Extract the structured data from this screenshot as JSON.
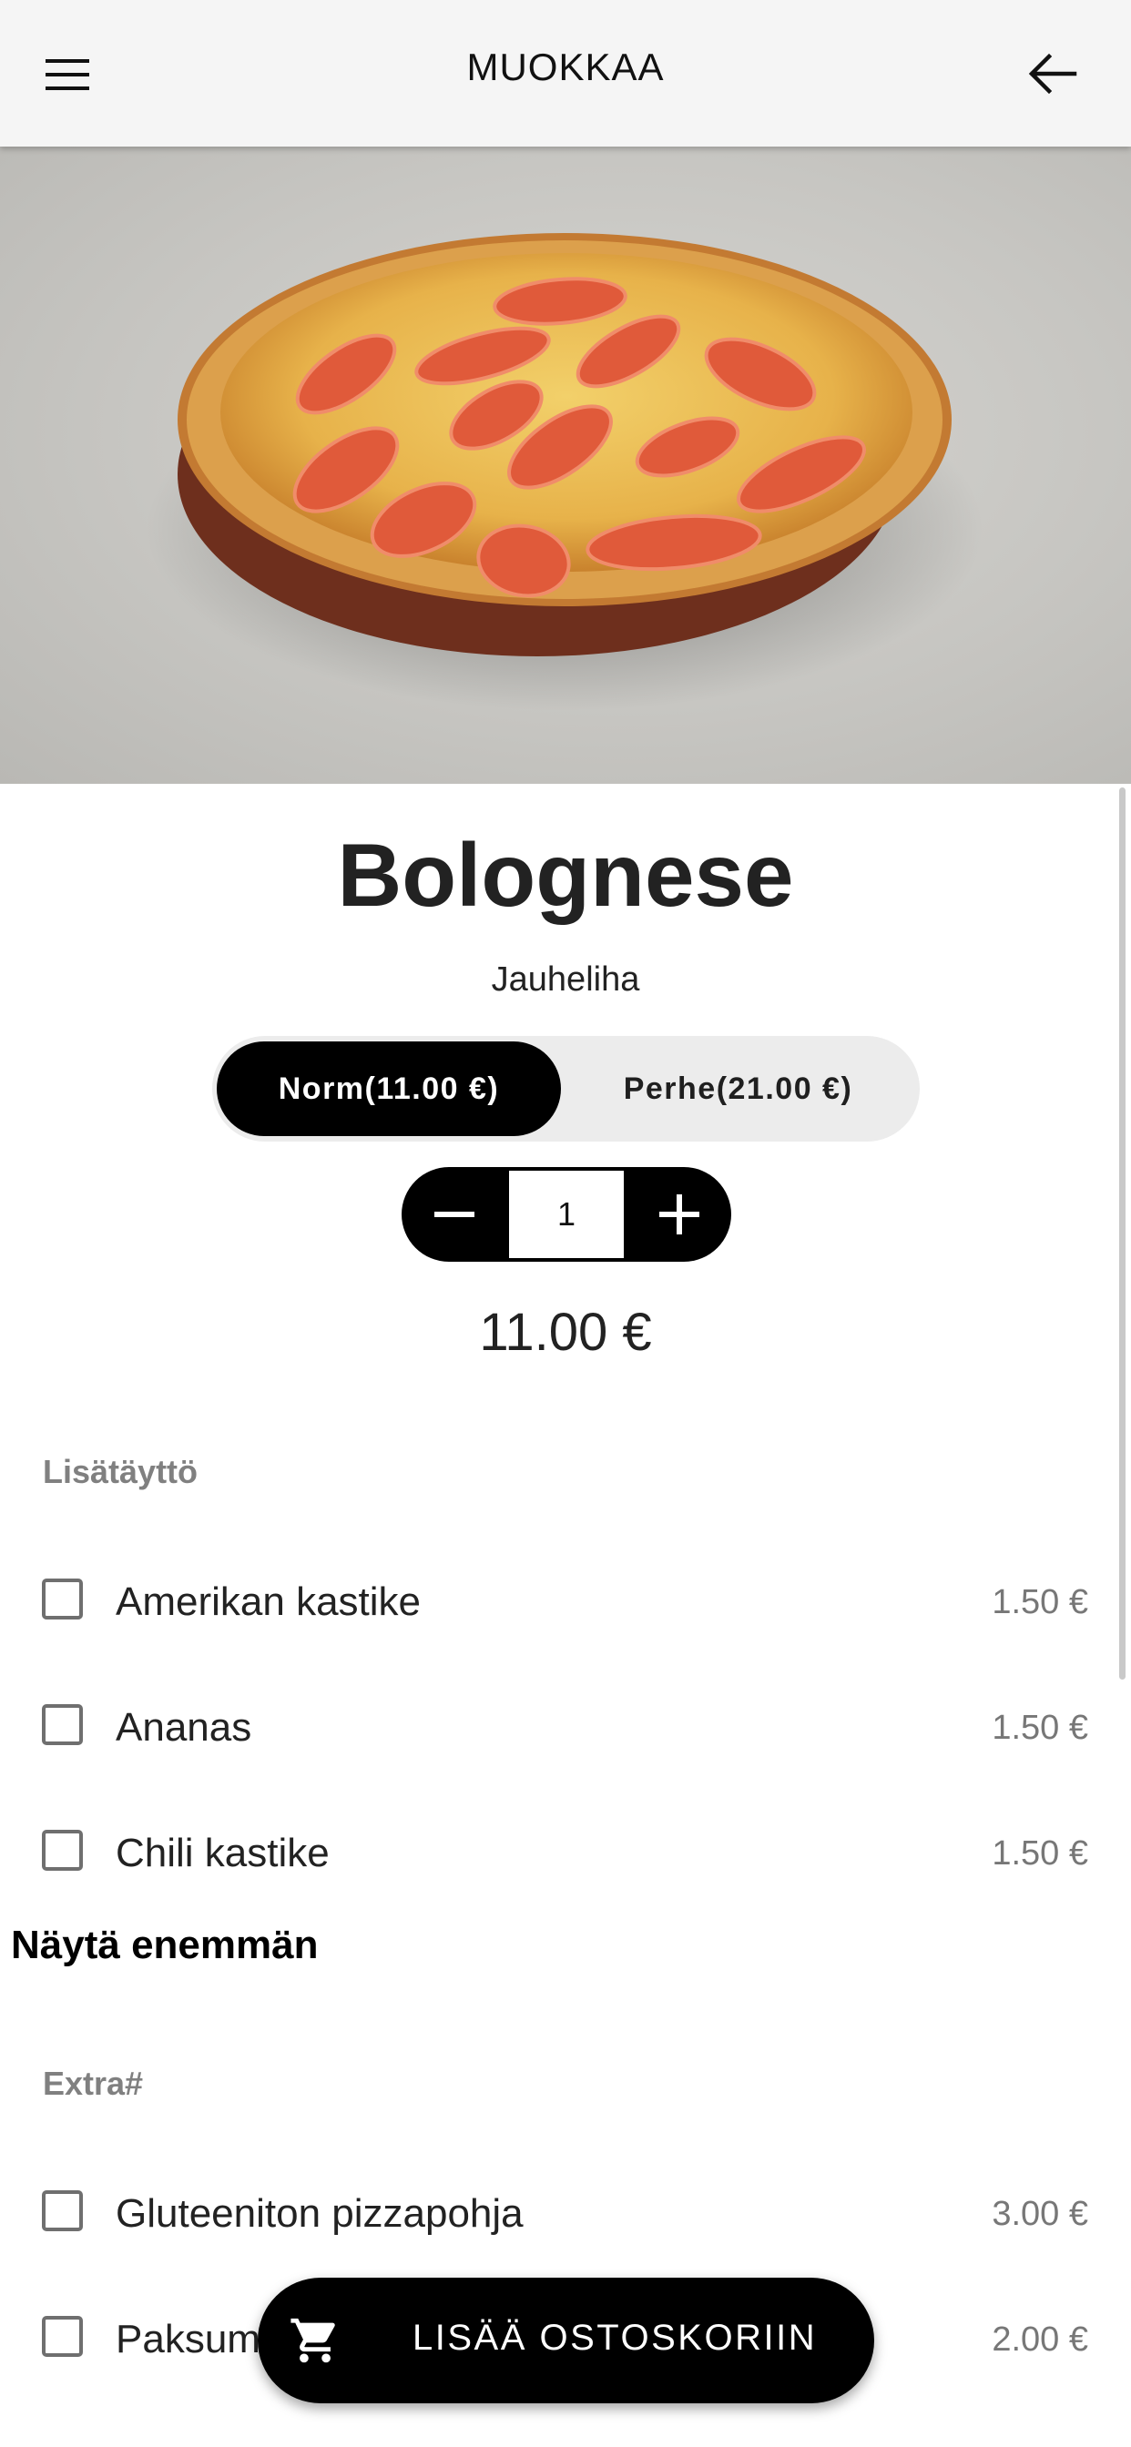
{
  "header": {
    "title": "MUOKKAA",
    "menu_icon": "hamburger-menu-icon",
    "back_icon": "arrow-left-icon"
  },
  "product": {
    "name": "Bolognese",
    "description": "Jauheliha",
    "sizes": [
      {
        "label": "Norm(11.00 €)",
        "selected": true
      },
      {
        "label": "Perhe(21.00 €)",
        "selected": false
      }
    ],
    "quantity": "1",
    "price": "11.00 €"
  },
  "sections": [
    {
      "title": "Lisätäyttö",
      "options": [
        {
          "label": "Amerikan kastike",
          "price": "1.50 €",
          "checked": false
        },
        {
          "label": "Ananas",
          "price": "1.50 €",
          "checked": false
        },
        {
          "label": "Chili kastike",
          "price": "1.50 €",
          "checked": false
        }
      ],
      "show_more": "Näytä enemmän"
    },
    {
      "title": "Extra#",
      "options": [
        {
          "label": "Gluteeniton pizzapohja",
          "price": "3.00 €",
          "checked": false
        },
        {
          "label": "Paksum",
          "price": "2.00 €",
          "checked": false
        }
      ]
    }
  ],
  "cart_button": {
    "label": "LISÄÄ OSTOSKORIIN",
    "icon": "shopping-cart-icon"
  },
  "colors": {
    "accent": "#000000",
    "appbar": "#f5f5f5",
    "muted_text": "#808080"
  }
}
